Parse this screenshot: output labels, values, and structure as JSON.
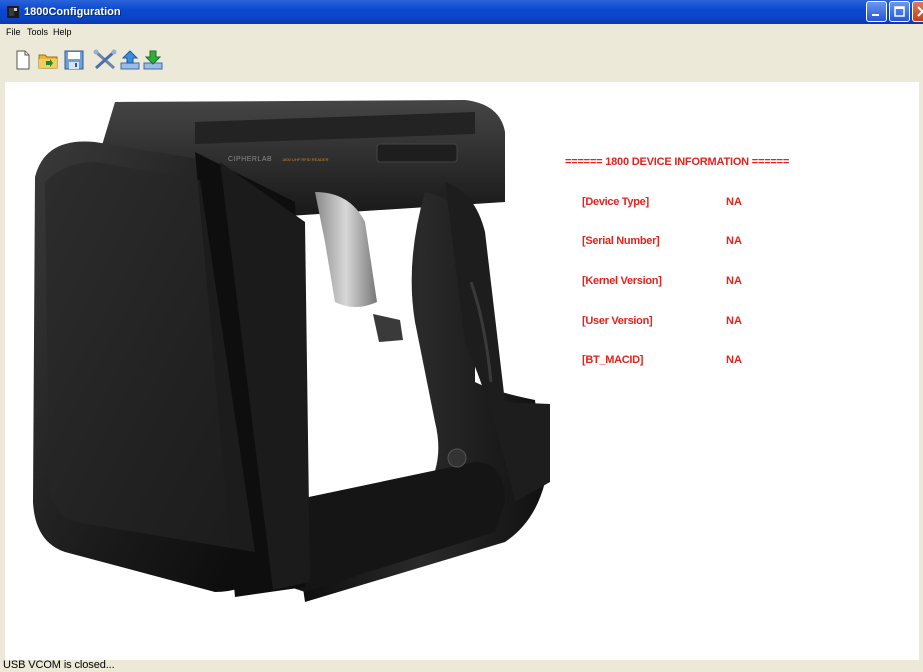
{
  "window": {
    "title": "1800Configuration"
  },
  "menu": {
    "items": [
      {
        "label": "File"
      },
      {
        "label": "Tools"
      },
      {
        "label": "Help"
      }
    ]
  },
  "toolbar": {
    "buttons": [
      {
        "icon": "new-file-icon"
      },
      {
        "icon": "open-folder-icon"
      },
      {
        "icon": "save-icon"
      },
      {
        "icon": "tools-icon"
      },
      {
        "icon": "upload-icon"
      },
      {
        "icon": "download-icon"
      }
    ]
  },
  "device_info": {
    "header": "====== 1800 DEVICE INFORMATION ======",
    "fields": [
      {
        "label": "[Device Type]",
        "value": "NA"
      },
      {
        "label": "[Serial Number]",
        "value": "NA"
      },
      {
        "label": "[Kernel Version]",
        "value": "NA"
      },
      {
        "label": "[User Version]",
        "value": "NA"
      },
      {
        "label": "[BT_MACID]",
        "value": "NA"
      }
    ],
    "text_color": "#e3231c"
  },
  "device_image": {
    "brand_text": "CIPHERLAB",
    "model_text": "1800 UHF RFID READER"
  },
  "status": {
    "text": "USB VCOM is closed..."
  }
}
